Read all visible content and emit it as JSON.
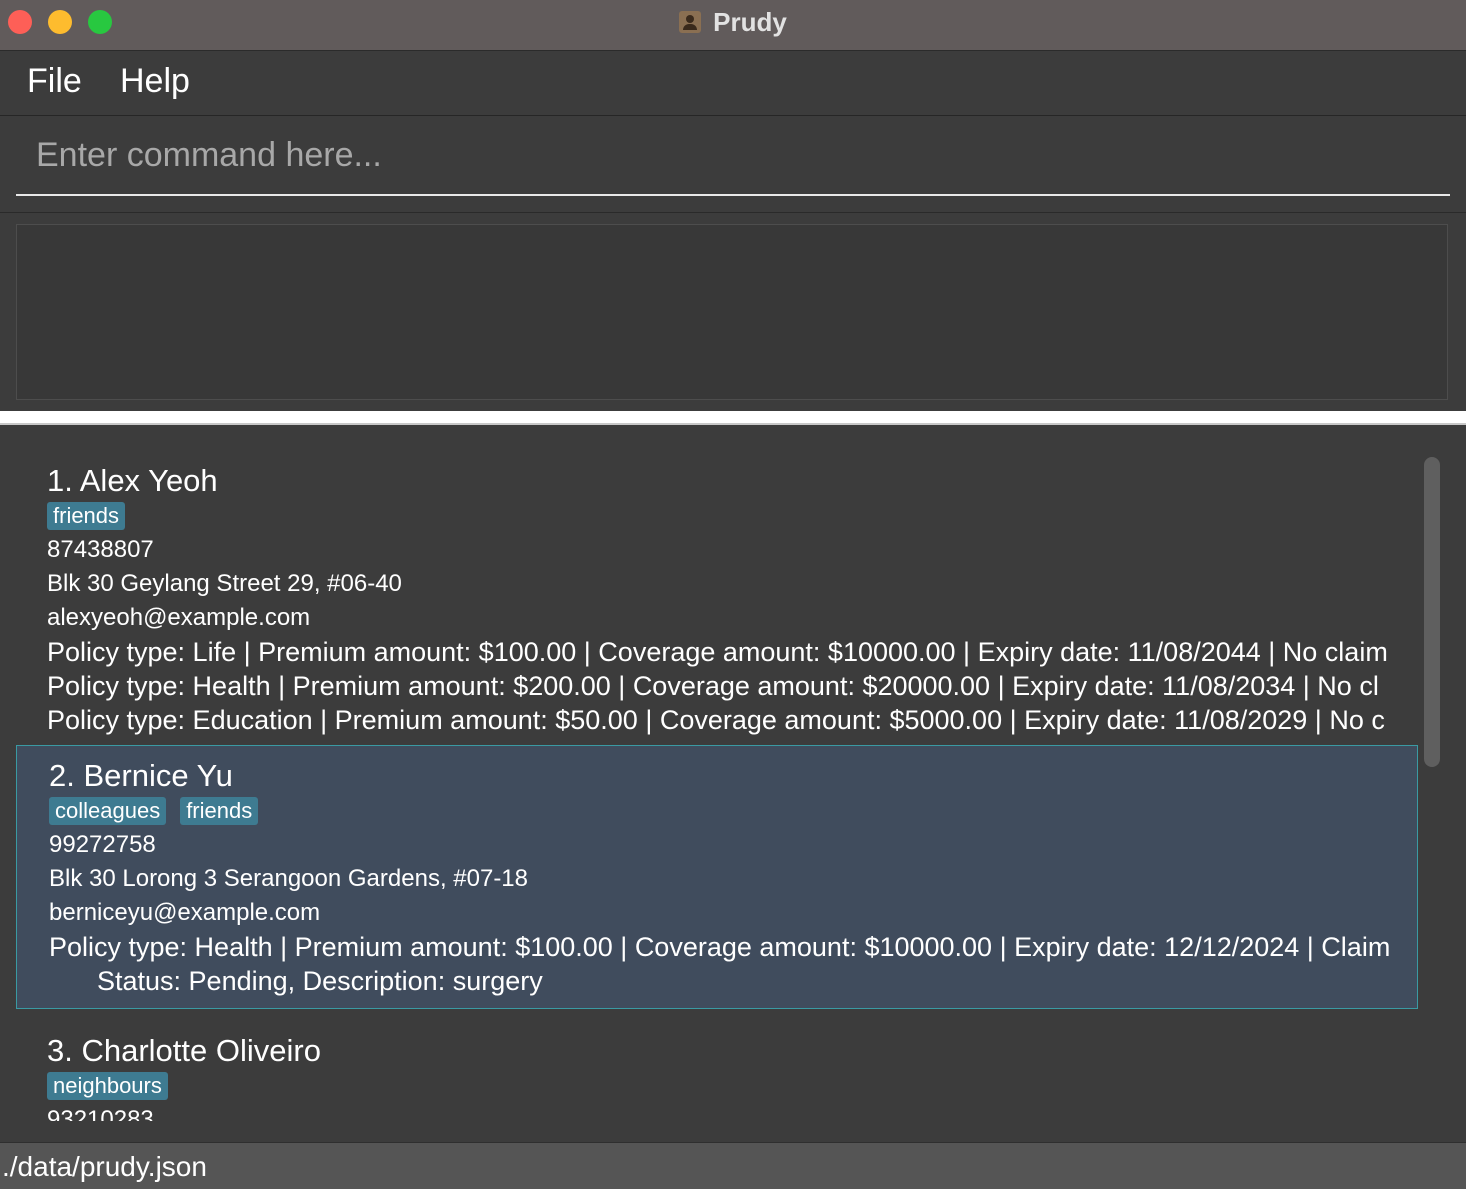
{
  "window": {
    "title": "Prudy"
  },
  "menu": {
    "file_label": "File",
    "help_label": "Help"
  },
  "command": {
    "placeholder": "Enter command here...",
    "value": ""
  },
  "result": {
    "text": ""
  },
  "persons": [
    {
      "name": "1. Alex Yeoh",
      "tags": [
        "friends"
      ],
      "phone": "87438807",
      "address": "Blk 30 Geylang Street 29, #06-40",
      "email": "alexyeoh@example.com",
      "policies": [
        "Policy type: Life | Premium amount: $100.00 | Coverage amount: $10000.00 | Expiry date: 11/08/2044 | No claim",
        "Policy type: Health | Premium amount: $200.00 | Coverage amount: $20000.00 | Expiry date: 11/08/2034 | No cl",
        "Policy type: Education | Premium amount: $50.00 | Coverage amount: $5000.00 | Expiry date: 11/08/2029 | No c"
      ]
    },
    {
      "name": "2. Bernice Yu",
      "tags": [
        "colleagues",
        "friends"
      ],
      "phone": "99272758",
      "address": "Blk 30 Lorong 3 Serangoon Gardens, #07-18",
      "email": "berniceyu@example.com",
      "policies": [
        "Policy type: Health | Premium amount: $100.00 | Coverage amount: $10000.00 | Expiry date: 12/12/2024 | Claim",
        "Status: Pending, Description: surgery"
      ]
    },
    {
      "name": "3. Charlotte Oliveiro",
      "tags": [
        "neighbours"
      ],
      "phone": "93210283"
    }
  ],
  "status": {
    "path": "./data/prudy.json"
  }
}
